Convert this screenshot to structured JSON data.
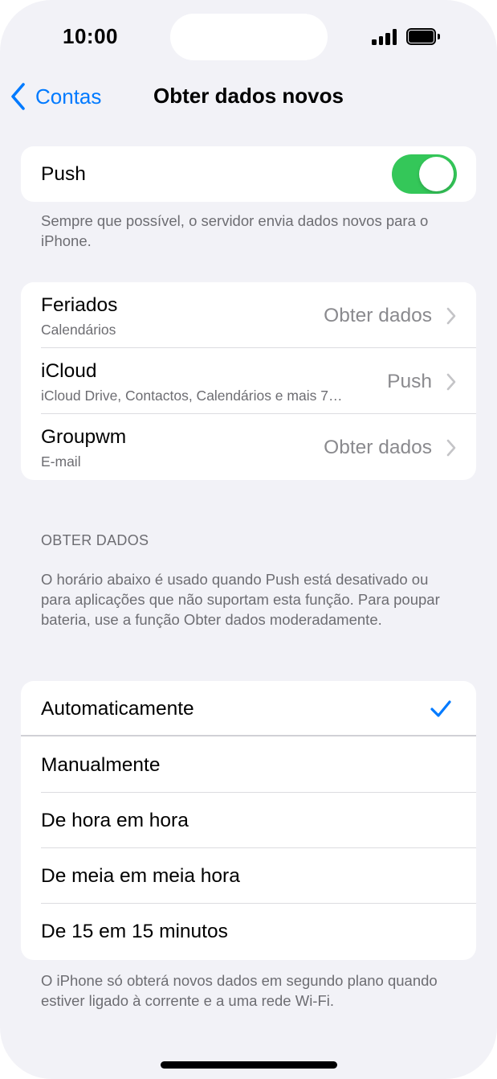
{
  "status_bar": {
    "time": "10:00"
  },
  "nav": {
    "back_label": "Contas",
    "title": "Obter dados novos"
  },
  "push": {
    "label": "Push",
    "enabled": true,
    "footnote": "Sempre que possível, o servidor envia dados novos para o iPhone."
  },
  "accounts": [
    {
      "name": "Feriados",
      "detail": "Calendários",
      "value": "Obter dados"
    },
    {
      "name": "iCloud",
      "detail": "iCloud Drive, Contactos, Calendários e mais 7…",
      "value": "Push"
    },
    {
      "name": "Groupwm",
      "detail": "E-mail",
      "value": "Obter dados"
    }
  ],
  "fetch": {
    "header": "OBTER DADOS",
    "description": "O horário abaixo é usado quando Push está desativado ou para aplicações que não suportam esta função. Para poupar bateria, use a função Obter dados moderadamente.",
    "options": [
      {
        "label": "Automaticamente",
        "selected": true
      },
      {
        "label": "Manualmente",
        "selected": false
      },
      {
        "label": "De hora em hora",
        "selected": false
      },
      {
        "label": "De meia em meia hora",
        "selected": false
      },
      {
        "label": "De 15 em 15 minutos",
        "selected": false
      }
    ],
    "footnote": "O iPhone só obterá novos dados em segundo plano quando estiver ligado à corrente e a uma rede Wi-Fi."
  },
  "colors": {
    "accent": "#007aff",
    "toggle_on": "#34c759",
    "background": "#f2f2f7"
  }
}
